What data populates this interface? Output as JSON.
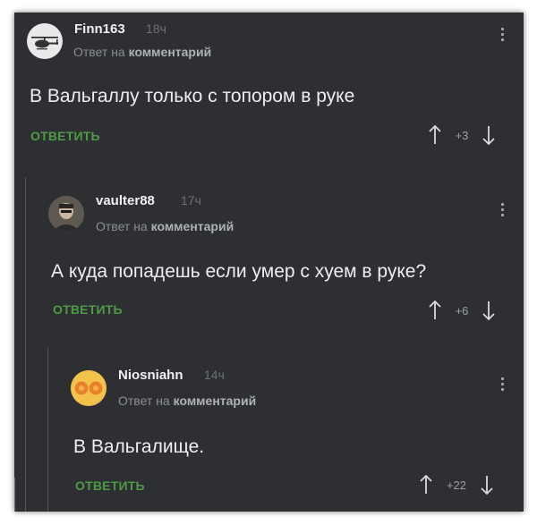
{
  "reply_to_prefix": "Ответ на",
  "reply_to_target": "комментарий",
  "reply_label": "ОТВЕТИТЬ",
  "comments": [
    {
      "username": "Finn163",
      "time": "18ч",
      "text": "В Вальгаллу только с топором в руке",
      "score": "+3",
      "avatar_icon": "helicopter-icon"
    },
    {
      "username": "vaulter88",
      "time": "17ч",
      "text": "А куда попадешь если умер с хуем в руке?",
      "score": "+6",
      "avatar_icon": "person-photo-icon"
    },
    {
      "username": "Niosniahn",
      "time": "14ч",
      "text": "В Вальгалище.",
      "score": "+22",
      "avatar_icon": "orange-eyes-icon"
    }
  ],
  "colors": {
    "background": "#2e2f33",
    "accent_green": "#4f9a45",
    "text": "#eceef0",
    "muted": "#8a8d92"
  }
}
